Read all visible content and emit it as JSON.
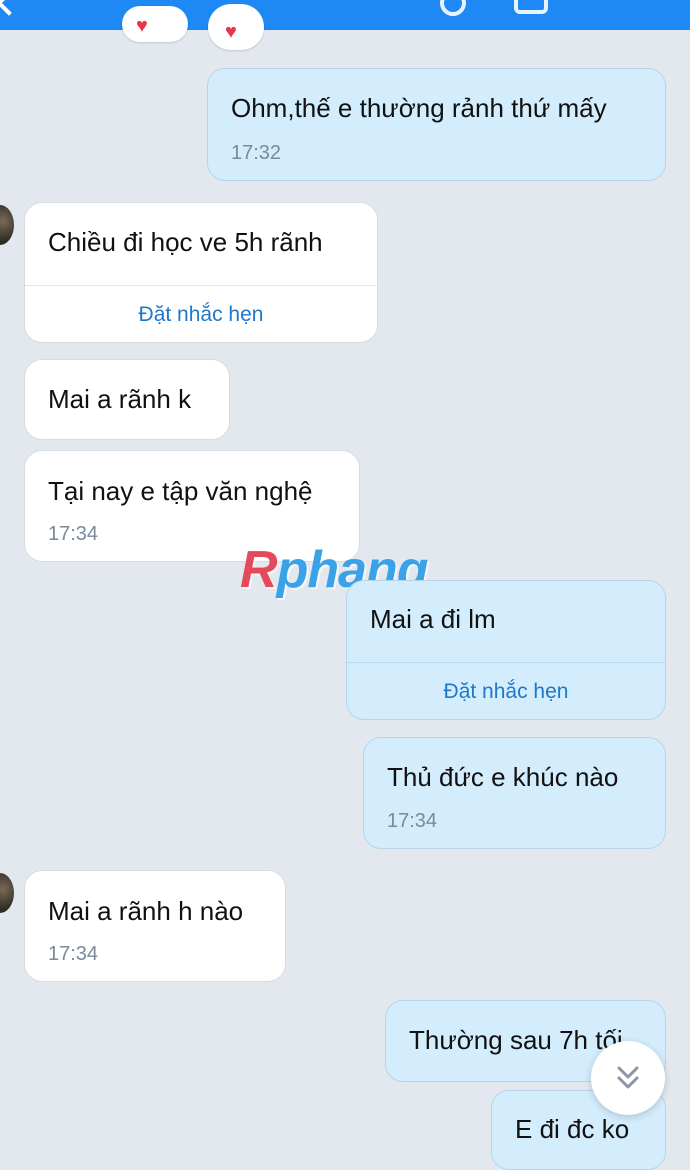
{
  "messages": [
    {
      "id": "m1",
      "dir": "out",
      "text": "Ohm,thế e thường rảnh thứ mấy",
      "time": "17:32"
    },
    {
      "id": "m2",
      "dir": "in",
      "text": "Chiều đi học ve 5h rãnh",
      "action": "Đặt nhắc hẹn"
    },
    {
      "id": "m3",
      "dir": "in",
      "text": "Mai a rãnh k"
    },
    {
      "id": "m4",
      "dir": "in",
      "text": "Tại nay e tập văn nghệ",
      "time": "17:34"
    },
    {
      "id": "m5",
      "dir": "out",
      "text": "Mai a đi lm",
      "action": "Đặt nhắc hẹn"
    },
    {
      "id": "m6",
      "dir": "out",
      "text": "Thủ đức e khúc nào",
      "time": "17:34"
    },
    {
      "id": "m7",
      "dir": "in",
      "text": "Mai a rãnh h nào",
      "time": "17:34"
    },
    {
      "id": "m8",
      "dir": "out",
      "text": "Thường sau 7h tối"
    },
    {
      "id": "m9",
      "dir": "out",
      "text": "E đi đc ko"
    }
  ],
  "watermark": {
    "first": "R",
    "rest": "phang"
  },
  "icons": {
    "scroll_down": "double-chevron-down-icon",
    "reaction": "heart-icon"
  },
  "colors": {
    "header": "#1e88f5",
    "outgoing": "#d3edfd",
    "incoming": "#ffffff",
    "link": "#1f78c8"
  }
}
